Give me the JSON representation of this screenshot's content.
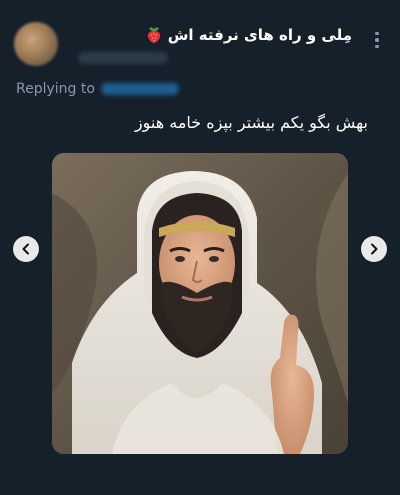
{
  "tweet": {
    "display_name": "مِلی و راه های نرفته اش",
    "name_emoji_icon": "strawberry-icon",
    "replying_label": "Replying to",
    "text": "بهش بگو یکم بیشتر بپزه خامه هنوز",
    "more_icon": "more-vertical-icon"
  },
  "media": {
    "prev_icon": "chevron-left-icon",
    "next_icon": "chevron-right-icon"
  },
  "colors": {
    "background": "#15202b",
    "secondary_text": "#8b98a5",
    "link": "#1d9bf0",
    "carousel_button": "#e7e9ea"
  }
}
